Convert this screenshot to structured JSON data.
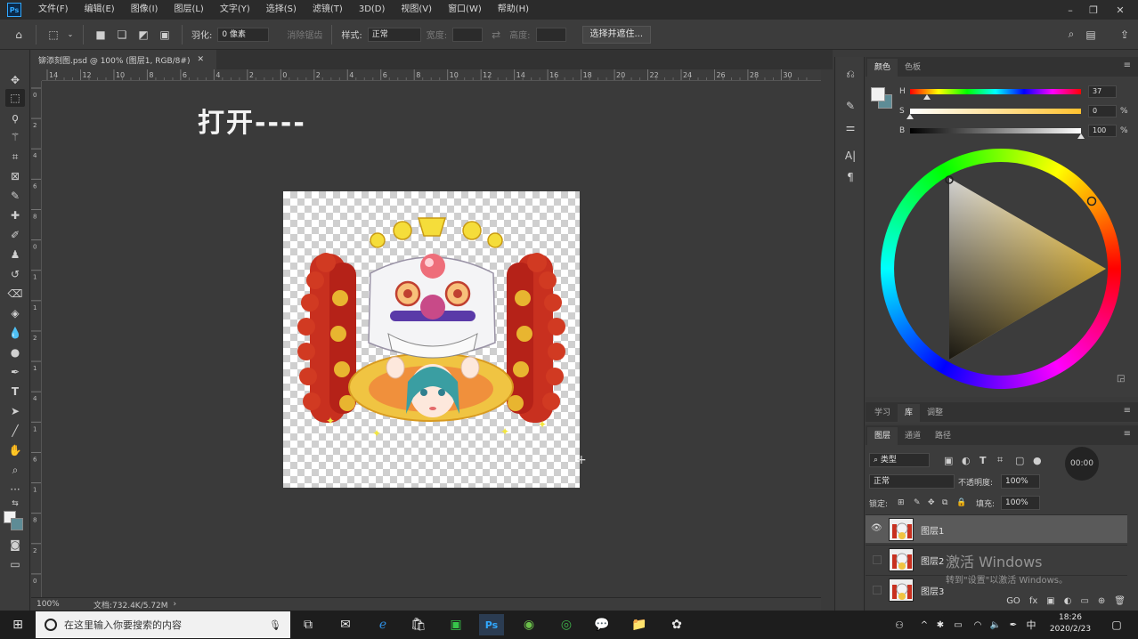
{
  "app": {
    "logo": "Ps",
    "menu": [
      "文件(F)",
      "编辑(E)",
      "图像(I)",
      "图层(L)",
      "文字(Y)",
      "选择(S)",
      "滤镜(T)",
      "3D(D)",
      "视图(V)",
      "窗口(W)",
      "帮助(H)"
    ]
  },
  "options": {
    "feather_label": "羽化:",
    "feather_value": "0 像素",
    "antialias_label": "消除锯齿",
    "style_label": "样式:",
    "style_value": "正常",
    "width_label": "宽度:",
    "height_label": "高度:",
    "select_mask_button": "选择并遮住..."
  },
  "document": {
    "tab_title": "铆添刻图.psd @ 100% (图层1, RGB/8#)",
    "overlay_text": "打开----",
    "zoom": "100%",
    "doc_info": "文档:732.4K/5.72M"
  },
  "ruler": {
    "top_labels": [
      "14",
      "12",
      "10",
      "8",
      "6",
      "4",
      "2",
      "0",
      "2",
      "4",
      "6",
      "8",
      "10",
      "12",
      "14",
      "16",
      "18",
      "20",
      "22",
      "24",
      "26",
      "28",
      "30"
    ],
    "left_labels": [
      "0",
      "2",
      "4",
      "6",
      "8",
      "0",
      "1",
      "1",
      "2",
      "1",
      "4",
      "1",
      "6",
      "1",
      "8",
      "2",
      "0"
    ]
  },
  "color_panel": {
    "tabs": [
      "颜色",
      "色板"
    ],
    "h_label": "H",
    "h_value": "37",
    "s_label": "S",
    "s_value": "0",
    "b_label": "B",
    "b_value": "100",
    "percent": "%",
    "h_fraction": 0.1,
    "s_fraction": 0.0,
    "b_fraction": 1.0
  },
  "learn_panel": {
    "tabs": [
      "学习",
      "库",
      "调整"
    ]
  },
  "layers_panel": {
    "tabs": [
      "图层",
      "通道",
      "路径"
    ],
    "filter_value": "类型",
    "blend_mode": "正常",
    "opacity_label": "不透明度:",
    "opacity_value": "100%",
    "lock_label": "锁定:",
    "fill_label": "填充:",
    "fill_value": "100%",
    "layers": [
      {
        "name": "图层1",
        "visible": true,
        "selected": true
      },
      {
        "name": "图层2",
        "visible": false,
        "selected": false
      },
      {
        "name": "图层3",
        "visible": false,
        "selected": false
      }
    ],
    "footer": [
      "GO",
      "fx"
    ]
  },
  "recorder": {
    "time": "00:00"
  },
  "watermark": {
    "line1": "激活 Windows",
    "line2": "转到\"设置\"以激活 Windows。"
  },
  "taskbar": {
    "search_placeholder": "在这里输入你要搜索的内容",
    "time": "18:26",
    "date": "2020/2/23",
    "ime": "中"
  },
  "colors": {
    "accent": "#31a8ff",
    "panel_bg": "#3c3c3c",
    "canvas_bg": "#3a3a3a"
  }
}
